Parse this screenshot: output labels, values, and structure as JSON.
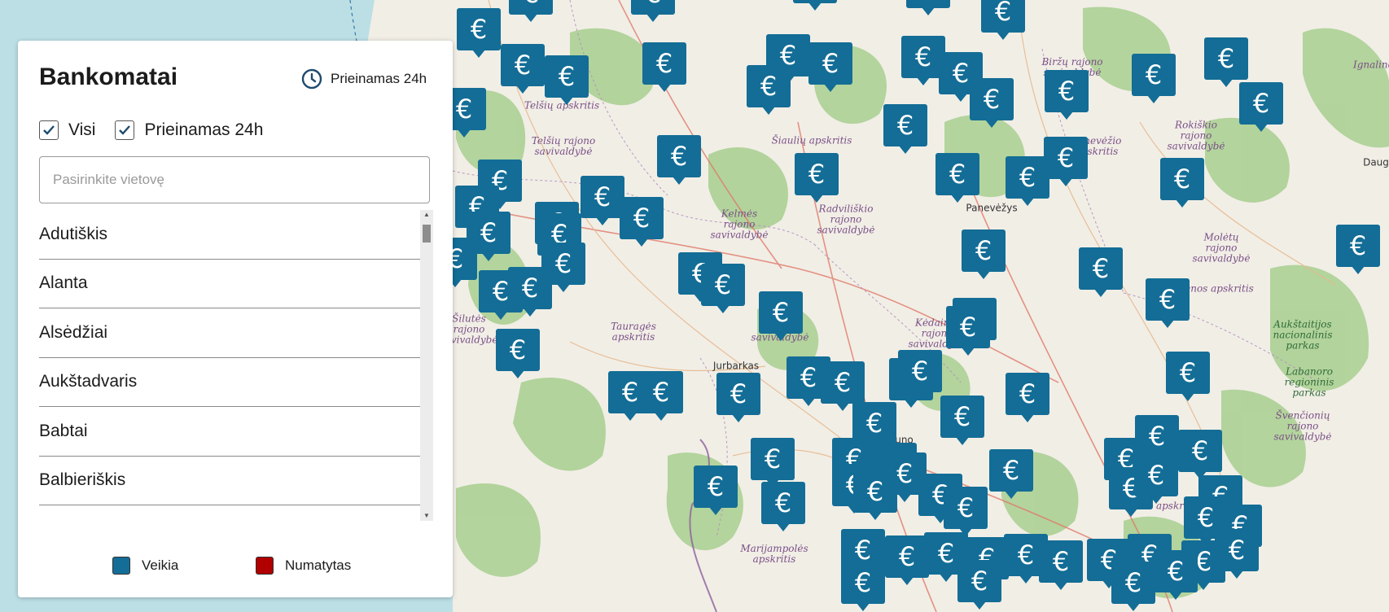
{
  "panel": {
    "title": "Bankomatai",
    "availability_badge": "Prieinamas 24h",
    "filters": [
      {
        "label": "Visi",
        "checked": true
      },
      {
        "label": "Prieinamas 24h",
        "checked": true
      }
    ],
    "search_placeholder": "Pasirinkite vietovę",
    "locations": [
      "Adutiškis",
      "Alanta",
      "Alsėdžiai",
      "Aukštadvaris",
      "Babtai",
      "Balbieriškis"
    ],
    "legend": [
      {
        "label": "Veikia",
        "color": "#136d96"
      },
      {
        "label": "Numatytas",
        "color": "#b00000"
      }
    ]
  },
  "map": {
    "marker_symbol": "€",
    "marker_color": "#136d96",
    "labels": [
      {
        "text": "Telšių apskritis",
        "style": "region"
      },
      {
        "text": "Telšių rajono\nsavivaldybė",
        "style": "region"
      },
      {
        "text": "Šiaulių apskritis",
        "style": "region"
      },
      {
        "text": "Biržų rajono\nsavivaldybė",
        "style": "region"
      },
      {
        "text": "Panevėžio\napskritis",
        "style": "region"
      },
      {
        "text": "Rokiškio\nrajono\nsavivaldybė",
        "style": "region"
      },
      {
        "text": "Kelmės\nrajono\nsavivaldybė",
        "style": "region"
      },
      {
        "text": "Radviliškio\nrajono\nsavivaldybė",
        "style": "region"
      },
      {
        "text": "Panevėžys",
        "style": "city"
      },
      {
        "text": "Tauragės\napskritis",
        "style": "region"
      },
      {
        "text": "Šilutės\nrajono\nsavivaldybė",
        "style": "region"
      },
      {
        "text": "Kėdainių\nrajono\nsavivaldybė",
        "style": "region"
      },
      {
        "text": "Utenos apskritis",
        "style": "region"
      },
      {
        "text": "Aukštaitijos\nnacionalinis\nparkas",
        "style": "park"
      },
      {
        "text": "Labanoro\nregioninis\nparkas",
        "style": "park"
      },
      {
        "text": "Švenčionių\nrajono\nsavivaldybė",
        "style": "region"
      },
      {
        "text": "Jurbarkas",
        "style": "city"
      },
      {
        "text": "Kauno",
        "style": "city"
      },
      {
        "text": "Vilniaus apskritis",
        "style": "region"
      },
      {
        "text": "Marijampolės\napskritis",
        "style": "region"
      },
      {
        "text": "Daug",
        "style": "city"
      },
      {
        "text": "Ignalinos",
        "style": "region"
      },
      {
        "text": "Molėtų\nrajono\nsavivaldybė",
        "style": "region"
      },
      {
        "text": "savivaldybė",
        "style": "region"
      }
    ]
  }
}
